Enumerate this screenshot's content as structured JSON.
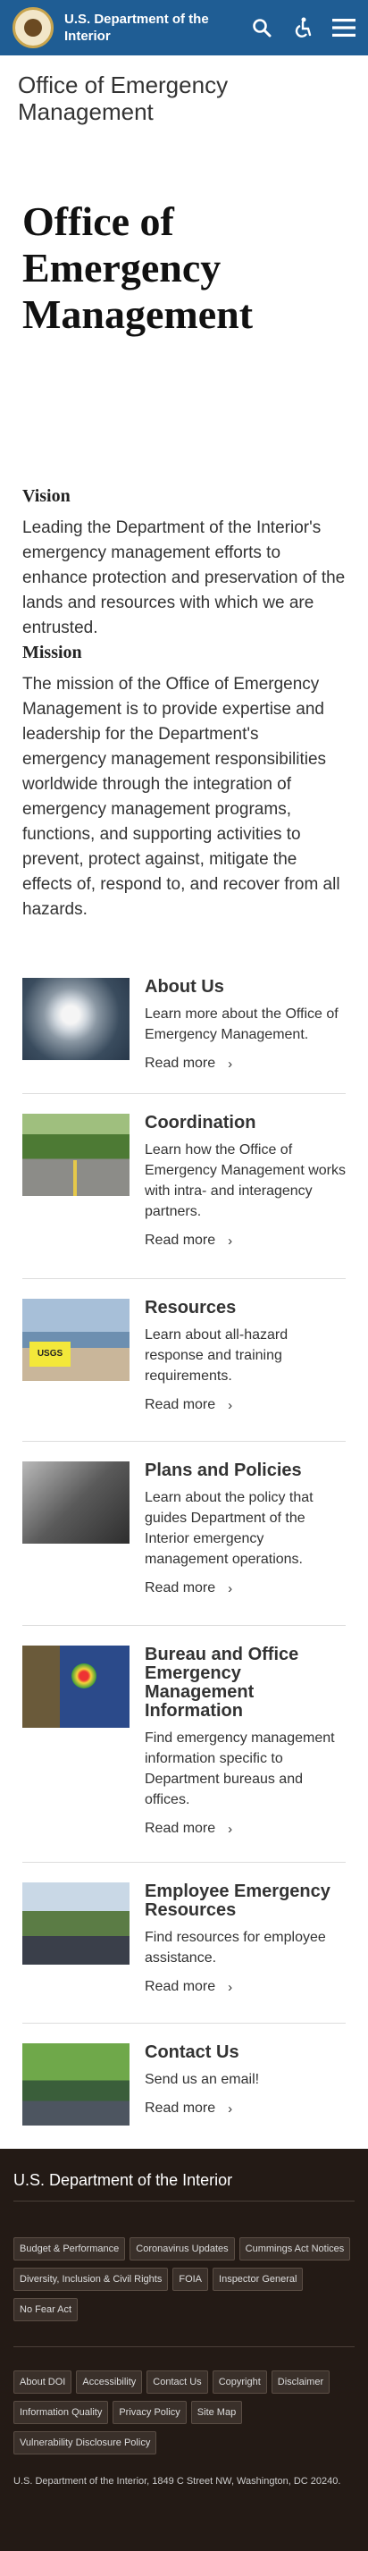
{
  "header": {
    "site_name": "U.S. Department of the Interior"
  },
  "page": {
    "band_title": "Office of Emergency Management",
    "title": "Office of Emergency Management"
  },
  "vision": {
    "heading": "Vision",
    "text": "Leading the Department of the Interior's emergency management efforts to enhance protection and preservation of the lands and resources with which we are entrusted."
  },
  "mission": {
    "heading": "Mission",
    "text": "The mission of the Office of Emergency Management is to provide expertise and leadership for the Department's emergency management responsibilities worldwide through the integration of emergency management programs, functions, and supporting activities to prevent, protect against, mitigate the effects of, respond to, and recover from all hazards."
  },
  "cards": [
    {
      "title": "About Us",
      "desc": "Learn more about the Office of Emergency Management.",
      "more": "Read more"
    },
    {
      "title": "Coordination",
      "desc": "Learn how the Office of Emergency Management works with intra- and interagency partners.",
      "more": "Read more"
    },
    {
      "title": "Resources",
      "desc": "Learn about all-hazard response and training requirements.",
      "more": "Read more"
    },
    {
      "title": "Plans and Policies",
      "desc": "Learn about the policy that guides Department of the Interior emergency management operations.",
      "more": "Read more"
    },
    {
      "title": "Bureau and Office Emergency Management Information",
      "desc": "Find emergency management information specific to Department bureaus and offices.",
      "more": "Read more"
    },
    {
      "title": "Employee Emergency Resources",
      "desc": "Find resources for employee assistance.",
      "more": "Read more"
    },
    {
      "title": "Contact Us",
      "desc": "Send us an email!",
      "more": "Read more"
    }
  ],
  "footer": {
    "title": "U.S. Department of the Interior",
    "links_top": [
      "Budget & Performance",
      "Coronavirus Updates",
      "Cummings Act Notices",
      "Diversity, Inclusion & Civil Rights",
      "FOIA",
      "Inspector General",
      "No Fear Act"
    ],
    "links_bottom": [
      "About DOI",
      "Accessibility",
      "Contact Us",
      "Copyright",
      "Disclaimer",
      "Information Quality",
      "Privacy Policy",
      "Site Map",
      "Vulnerability Disclosure Policy"
    ],
    "address": "U.S. Department of the Interior, 1849 C Street NW, Washington, DC 20240."
  }
}
